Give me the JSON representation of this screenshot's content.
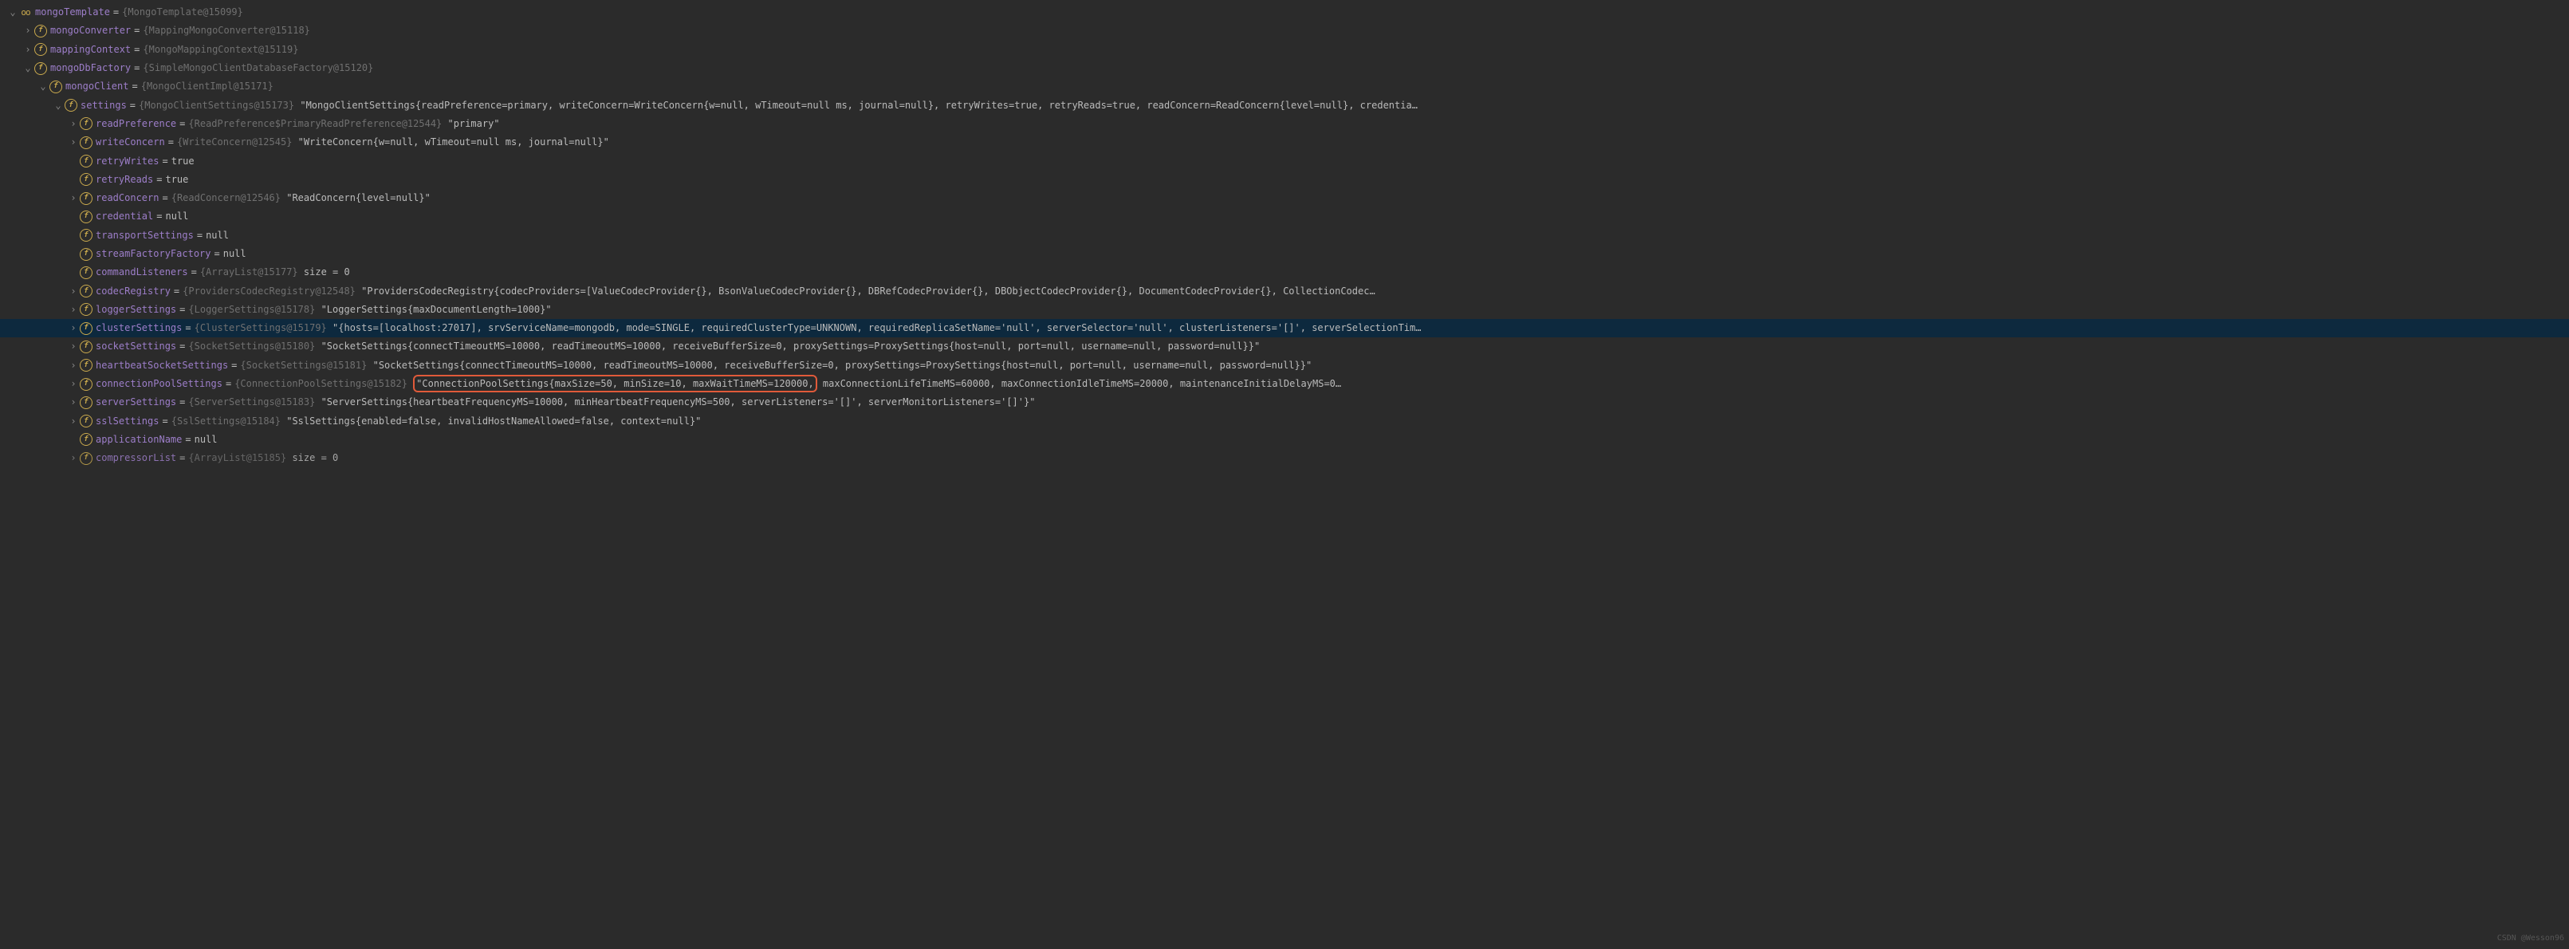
{
  "watermark": "CSDN @Wesson96",
  "icons": {
    "f": "f",
    "oo": "oo"
  },
  "rows": [
    {
      "indent": 0,
      "arrow": "down",
      "icon": "oo",
      "name": "mongoTemplate",
      "obj": "{MongoTemplate@15099}",
      "str": null,
      "tail": null
    },
    {
      "indent": 1,
      "arrow": "right",
      "icon": "f",
      "name": "mongoConverter",
      "obj": "{MappingMongoConverter@15118}",
      "str": null,
      "tail": null
    },
    {
      "indent": 1,
      "arrow": "right",
      "icon": "f",
      "name": "mappingContext",
      "obj": "{MongoMappingContext@15119}",
      "str": null,
      "tail": null
    },
    {
      "indent": 1,
      "arrow": "down",
      "icon": "f",
      "name": "mongoDbFactory",
      "obj": "{SimpleMongoClientDatabaseFactory@15120}",
      "str": null,
      "tail": null
    },
    {
      "indent": 2,
      "arrow": "down",
      "icon": "f",
      "name": "mongoClient",
      "obj": "{MongoClientImpl@15171}",
      "str": null,
      "tail": null
    },
    {
      "indent": 3,
      "arrow": "down",
      "icon": "f",
      "name": "settings",
      "obj": "{MongoClientSettings@15173}",
      "str": "\"MongoClientSettings{readPreference=primary, writeConcern=WriteConcern{w=null, wTimeout=null ms, journal=null}, retryWrites=true, retryReads=true, readConcern=ReadConcern{level=null}, credentia…",
      "tail": null
    },
    {
      "indent": 4,
      "arrow": "right",
      "icon": "f",
      "name": "readPreference",
      "obj": "{ReadPreference$PrimaryReadPreference@12544}",
      "str": "\"primary\"",
      "tail": null
    },
    {
      "indent": 4,
      "arrow": "right",
      "icon": "f",
      "name": "writeConcern",
      "obj": "{WriteConcern@12545}",
      "str": "\"WriteConcern{w=null, wTimeout=null ms, journal=null}\"",
      "tail": null
    },
    {
      "indent": 4,
      "arrow": "none",
      "icon": "f",
      "name": "retryWrites",
      "obj": null,
      "str": "true",
      "tail": null
    },
    {
      "indent": 4,
      "arrow": "none",
      "icon": "f",
      "name": "retryReads",
      "obj": null,
      "str": "true",
      "tail": null
    },
    {
      "indent": 4,
      "arrow": "right",
      "icon": "f",
      "name": "readConcern",
      "obj": "{ReadConcern@12546}",
      "str": "\"ReadConcern{level=null}\"",
      "tail": null
    },
    {
      "indent": 4,
      "arrow": "none",
      "icon": "f",
      "name": "credential",
      "obj": null,
      "str": "null",
      "tail": null
    },
    {
      "indent": 4,
      "arrow": "none",
      "icon": "f",
      "name": "transportSettings",
      "obj": null,
      "str": "null",
      "tail": null
    },
    {
      "indent": 4,
      "arrow": "none",
      "icon": "f",
      "name": "streamFactoryFactory",
      "obj": null,
      "str": "null",
      "tail": null
    },
    {
      "indent": 4,
      "arrow": "none",
      "icon": "f",
      "name": "commandListeners",
      "obj": "{ArrayList@15177}",
      "str": null,
      "tail": " size = 0"
    },
    {
      "indent": 4,
      "arrow": "right",
      "icon": "f",
      "name": "codecRegistry",
      "obj": "{ProvidersCodecRegistry@12548}",
      "str": "\"ProvidersCodecRegistry{codecProviders=[ValueCodecProvider{}, BsonValueCodecProvider{}, DBRefCodecProvider{}, DBObjectCodecProvider{}, DocumentCodecProvider{}, CollectionCodec…",
      "tail": null
    },
    {
      "indent": 4,
      "arrow": "right",
      "icon": "f",
      "name": "loggerSettings",
      "obj": "{LoggerSettings@15178}",
      "str": "\"LoggerSettings{maxDocumentLength=1000}\"",
      "tail": null
    },
    {
      "indent": 4,
      "arrow": "right",
      "icon": "f",
      "name": "clusterSettings",
      "obj": "{ClusterSettings@15179}",
      "str": "\"{hosts=[localhost:27017], srvServiceName=mongodb, mode=SINGLE, requiredClusterType=UNKNOWN, requiredReplicaSetName='null', serverSelector='null', clusterListeners='[]', serverSelectionTim…",
      "tail": null,
      "selected": true
    },
    {
      "indent": 4,
      "arrow": "right",
      "icon": "f",
      "name": "socketSettings",
      "obj": "{SocketSettings@15180}",
      "str": "\"SocketSettings{connectTimeoutMS=10000, readTimeoutMS=10000, receiveBufferSize=0, proxySettings=ProxySettings{host=null, port=null, username=null, password=null}}\"",
      "tail": null
    },
    {
      "indent": 4,
      "arrow": "right",
      "icon": "f",
      "name": "heartbeatSocketSettings",
      "obj": "{SocketSettings@15181}",
      "str": "\"SocketSettings{connectTimeoutMS=10000, readTimeoutMS=10000, receiveBufferSize=0, proxySettings=ProxySettings{host=null, port=null, username=null, password=null}}\"",
      "tail": null
    },
    {
      "indent": 4,
      "arrow": "right",
      "icon": "f",
      "name": "connectionPoolSettings",
      "obj": "{ConnectionPoolSettings@15182}",
      "str": null,
      "tail": null,
      "highlight": "\"ConnectionPoolSettings{maxSize=50, minSize=10, maxWaitTimeMS=120000,",
      "after_highlight": " maxConnectionLifeTimeMS=60000, maxConnectionIdleTimeMS=20000, maintenanceInitialDelayMS=0…"
    },
    {
      "indent": 4,
      "arrow": "right",
      "icon": "f",
      "name": "serverSettings",
      "obj": "{ServerSettings@15183}",
      "str": "\"ServerSettings{heartbeatFrequencyMS=10000, minHeartbeatFrequencyMS=500, serverListeners='[]', serverMonitorListeners='[]'}\"",
      "tail": null
    },
    {
      "indent": 4,
      "arrow": "right",
      "icon": "f",
      "name": "sslSettings",
      "obj": "{SslSettings@15184}",
      "str": "\"SslSettings{enabled=false, invalidHostNameAllowed=false, context=null}\"",
      "tail": null
    },
    {
      "indent": 4,
      "arrow": "none",
      "icon": "f",
      "name": "applicationName",
      "obj": null,
      "str": "null",
      "tail": null
    },
    {
      "indent": 4,
      "arrow": "right",
      "icon": "f",
      "name": "compressorList",
      "obj": "{ArrayList@15185}",
      "str": null,
      "tail": " size = 0",
      "dim": true
    }
  ]
}
